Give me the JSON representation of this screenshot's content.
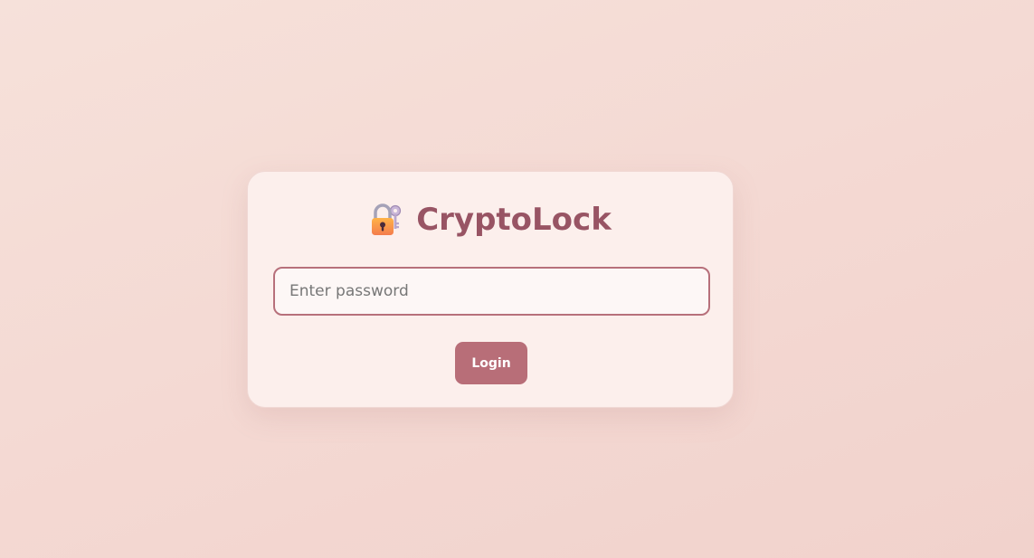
{
  "app": {
    "title": "CryptoLock"
  },
  "login_form": {
    "password_placeholder": "Enter password",
    "password_value": "",
    "login_label": "Login"
  },
  "icons": {
    "title_icon": "lock-with-key-icon"
  },
  "colors": {
    "title": "#985464",
    "accent": "#b86e78",
    "input_border": "#b7707b",
    "card_background": "#fcefec"
  }
}
